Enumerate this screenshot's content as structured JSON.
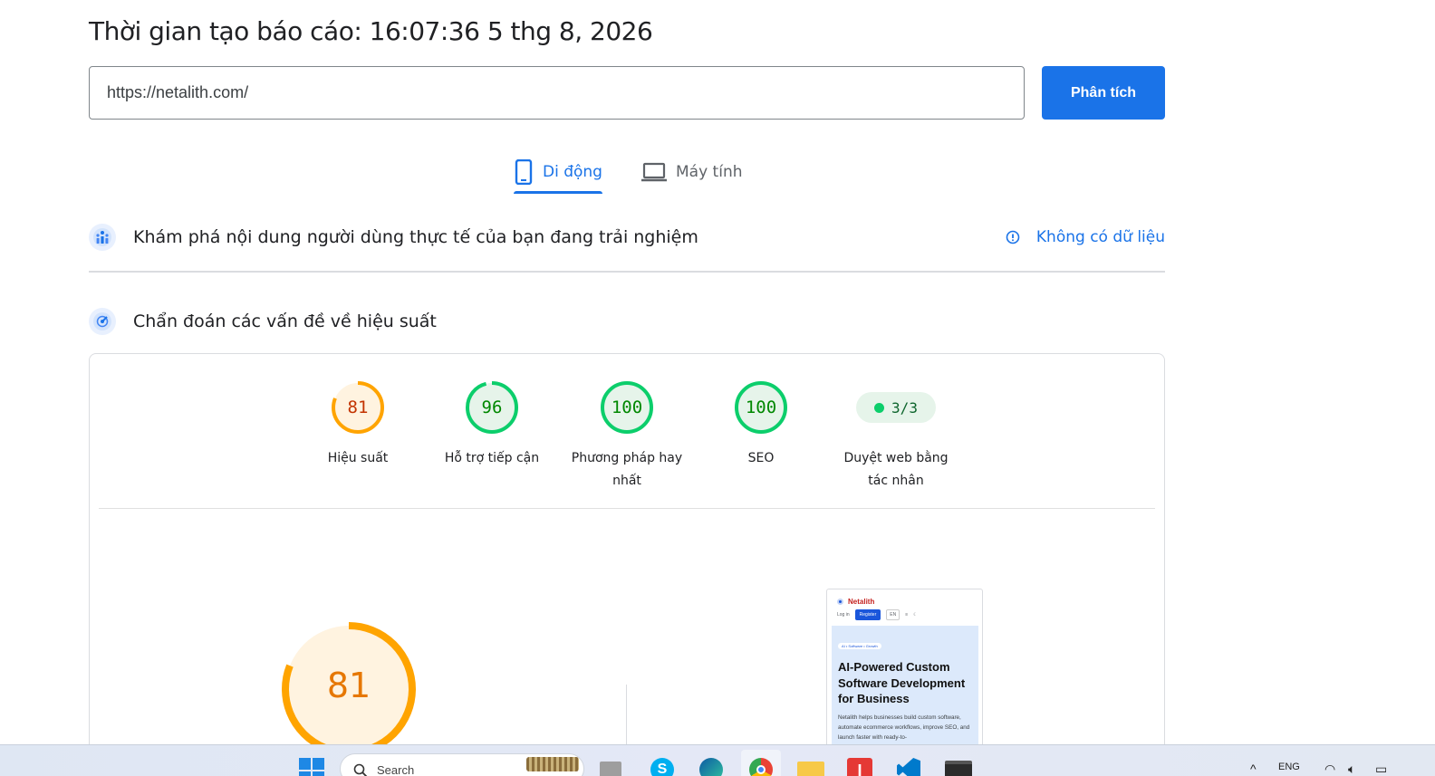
{
  "header": {
    "report_time": "Thời gian tạo báo cáo: 16:07:36 5 thg 8, 2026"
  },
  "search": {
    "url_value": "https://netalith.com/",
    "analyze_label": "Phân tích"
  },
  "tabs": [
    {
      "label": "Di động",
      "icon": "phone-icon",
      "active": true
    },
    {
      "label": "Máy tính",
      "icon": "laptop-icon",
      "active": false
    }
  ],
  "crux": {
    "title": "Khám phá nội dung người dùng thực tế của bạn đang trải nghiệm",
    "no_data_label": "Không có dữ liệu",
    "icon": "users-chart-icon",
    "info_icon": "info-icon"
  },
  "diagnostics": {
    "title": "Chẩn đoán các vấn đề về hiệu suất",
    "icon": "speedometer-icon"
  },
  "scores": [
    {
      "value": "81",
      "score": 81,
      "label": "Hiệu suất",
      "color": "#ffa400",
      "text_color": "#c33300",
      "fill": "#fff3e0"
    },
    {
      "value": "96",
      "score": 96,
      "label": "Hỗ trợ tiếp cận",
      "color": "#0cce6b",
      "text_color": "#008800",
      "fill": "#e6f4ea"
    },
    {
      "value": "100",
      "score": 100,
      "label": "Phương pháp hay nhất",
      "color": "#0cce6b",
      "text_color": "#008800",
      "fill": "#e6f4ea"
    },
    {
      "value": "100",
      "score": 100,
      "label": "SEO",
      "color": "#0cce6b",
      "text_color": "#008800",
      "fill": "#e6f4ea"
    }
  ],
  "agent": {
    "value": "3/3",
    "label": "Duyệt web bằng tác nhân",
    "color": "#0cce6b"
  },
  "big_gauge": {
    "value": "81",
    "score": 81,
    "color": "#ffa400"
  },
  "preview": {
    "brand": "Netalith",
    "nav": {
      "login": "Log in",
      "register": "Register",
      "lang": "EN",
      "menu_icon": "≡",
      "theme_icon": "☾"
    },
    "tagline": "AI • Software • Growth",
    "title": "AI-Powered Custom Software Development for Business",
    "description": "Netalith helps businesses build custom software, automate ecommerce workflows, improve SEO, and launch faster with ready-to-"
  },
  "taskbar": {
    "search_placeholder": "Search",
    "tray_lang": "ENG",
    "apps": [
      "windows-start-icon",
      "file-explorer-icon",
      "skype-icon",
      "edge-icon",
      "chrome-icon",
      "folder-icon",
      "red-app-icon",
      "vscode-icon",
      "terminal-icon"
    ]
  }
}
